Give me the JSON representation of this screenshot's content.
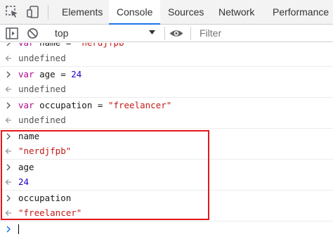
{
  "tabs": [
    "Elements",
    "Console",
    "Sources",
    "Network",
    "Performance"
  ],
  "active_tab": "Console",
  "toolbar": {
    "context": "top",
    "filter_placeholder": "Filter"
  },
  "console": {
    "entries": [
      {
        "kind": "input",
        "tokens": [
          [
            "kw",
            "var"
          ],
          [
            "plain",
            " name = "
          ],
          [
            "str",
            "\"nerdjfpb\""
          ]
        ]
      },
      {
        "kind": "result",
        "text": "undefined"
      },
      {
        "kind": "input",
        "tokens": [
          [
            "kw",
            "var"
          ],
          [
            "plain",
            " age = "
          ],
          [
            "num",
            "24"
          ]
        ]
      },
      {
        "kind": "result",
        "text": "undefined"
      },
      {
        "kind": "input",
        "tokens": [
          [
            "kw",
            "var"
          ],
          [
            "plain",
            " occupation = "
          ],
          [
            "str",
            "\"freelancer\""
          ]
        ]
      },
      {
        "kind": "result",
        "text": "undefined"
      },
      {
        "kind": "input",
        "tokens": [
          [
            "plain",
            "name"
          ]
        ]
      },
      {
        "kind": "result",
        "tokens": [
          [
            "str",
            "\"nerdjfpb\""
          ]
        ]
      },
      {
        "kind": "input",
        "tokens": [
          [
            "plain",
            "age"
          ]
        ]
      },
      {
        "kind": "result",
        "tokens": [
          [
            "num",
            "24"
          ]
        ]
      },
      {
        "kind": "input",
        "tokens": [
          [
            "plain",
            "occupation"
          ]
        ]
      },
      {
        "kind": "result",
        "tokens": [
          [
            "str",
            "\"freelancer\""
          ]
        ]
      }
    ]
  }
}
